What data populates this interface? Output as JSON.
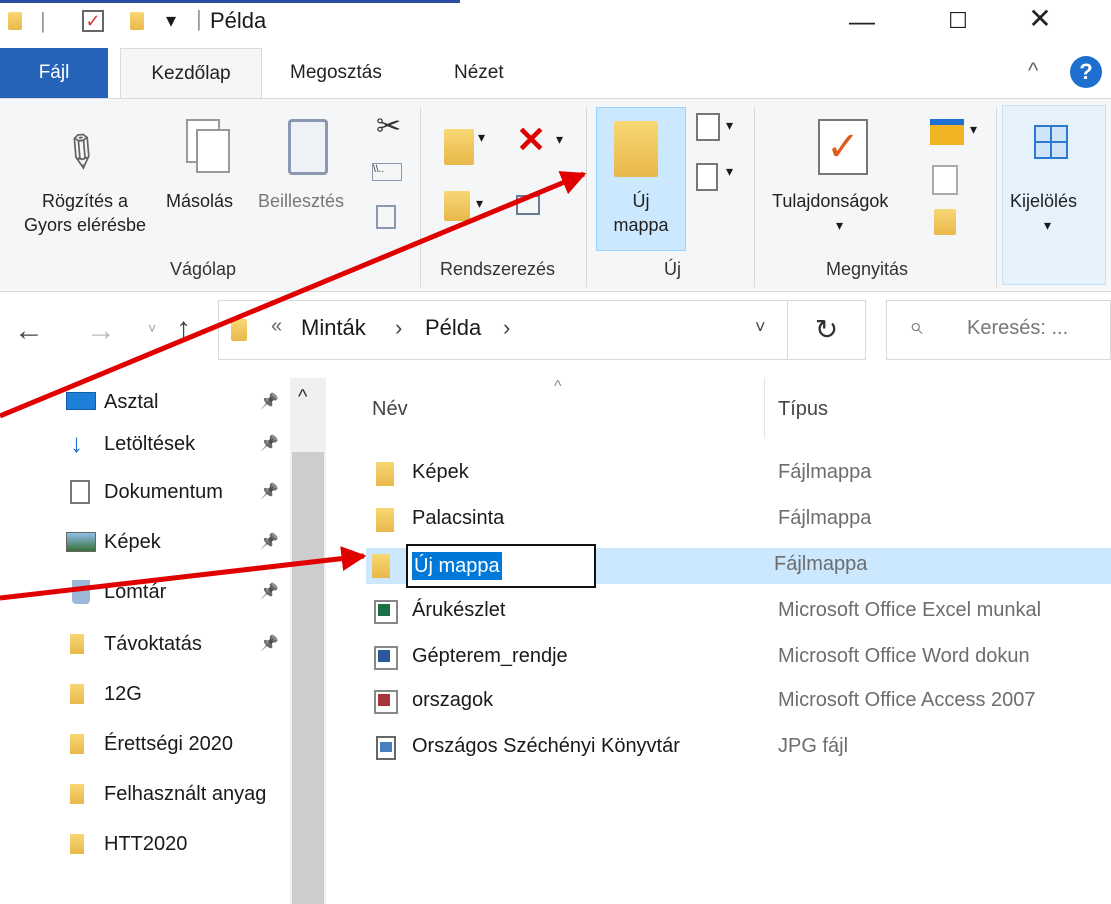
{
  "window": {
    "title": "Példa"
  },
  "tabs": {
    "file": "Fájl",
    "home": "Kezdőlap",
    "share": "Megosztás",
    "view": "Nézet"
  },
  "ribbon": {
    "pin_label_1": "Rögzítés a",
    "pin_label_2": "Gyors elérésbe",
    "copy": "Másolás",
    "paste": "Beillesztés",
    "clipboard_group": "Vágólap",
    "organize_group": "Rendszerezés",
    "new_folder_1": "Új",
    "new_folder_2": "mappa",
    "new_group": "Új",
    "properties": "Tulajdonságok",
    "open_group": "Megnyitás",
    "select": "Kijelölés"
  },
  "address": {
    "sep": "«",
    "crumb1": "Minták",
    "crumb2": "Példa",
    "search_placeholder": "Keresés: ..."
  },
  "nav": {
    "items": [
      {
        "label": "Asztal",
        "pinned": true
      },
      {
        "label": "Letöltések",
        "pinned": true
      },
      {
        "label": "Dokumentum",
        "pinned": true
      },
      {
        "label": "Képek",
        "pinned": true
      },
      {
        "label": "Lomtár",
        "pinned": true
      },
      {
        "label": "Távoktatás",
        "pinned": true
      },
      {
        "label": "12G",
        "pinned": false
      },
      {
        "label": "Érettségi 2020",
        "pinned": false
      },
      {
        "label": "Felhasznált anyag",
        "pinned": false
      },
      {
        "label": "HTT2020",
        "pinned": false
      }
    ]
  },
  "columns": {
    "name": "Név",
    "type": "Típus"
  },
  "files": [
    {
      "name": "Képek",
      "type": "Fájlmappa",
      "icon": "folder-icon"
    },
    {
      "name": "Palacsinta",
      "type": "Fájlmappa",
      "icon": "folder-icon"
    },
    {
      "name": "Új mappa",
      "type": "Fájlmappa",
      "icon": "folder-icon",
      "renaming": true
    },
    {
      "name": "Árukészlet",
      "type": "Microsoft Office Excel munkal",
      "icon": "excel-icon"
    },
    {
      "name": "Gépterem_rendje",
      "type": "Microsoft Office Word dokun",
      "icon": "word-icon"
    },
    {
      "name": "orszagok",
      "type": "Microsoft Office Access 2007",
      "icon": "access-icon"
    },
    {
      "name": "Országos Széchényi Könyvtár",
      "type": "JPG fájl",
      "icon": "image-icon"
    }
  ],
  "colors": {
    "accent": "#2563b8",
    "selection": "#cce8ff",
    "annotation_arrow": "#e00000"
  }
}
